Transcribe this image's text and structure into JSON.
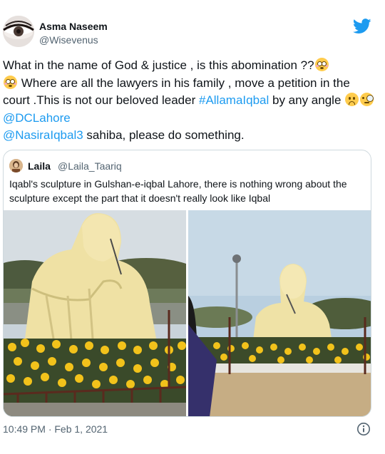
{
  "author": {
    "name": "Asma Naseem",
    "handle": "@Wisevenus"
  },
  "tweet": {
    "part1": "What in the name of God & justice , is this abomination ??",
    "part2": " Where are all the lawyers in his family , move a petition in the court .This is not our beloved leader ",
    "hashtag": "#AllamaIqbal",
    "part3": " by any angle ",
    "mention1": "@DCLahore",
    "mention2": "@NasiraIqbal3",
    "part4": " sahiba, please do something."
  },
  "quoted": {
    "name": "Laila",
    "handle": "@Laila_Taariq",
    "text": "Iqabl's sculpture in Gulshan-e-iqbal Lahore, there is nothing wrong about the sculpture except the part that it doesn't really look like Iqbal"
  },
  "footer": {
    "timestamp": "10:49 PM · Feb 1, 2021"
  },
  "icons": {
    "logo": "twitter-bird-icon",
    "info": "info-icon",
    "emoji_flushed": "flushed-face-emoji",
    "emoji_frown": "slightly-frowning-face-emoji",
    "emoji_monocle": "face-with-monocle-emoji"
  },
  "colors": {
    "link": "#1d9bf0",
    "secondary_text": "#536471",
    "border": "#cfd9de",
    "text": "#0f1419"
  }
}
